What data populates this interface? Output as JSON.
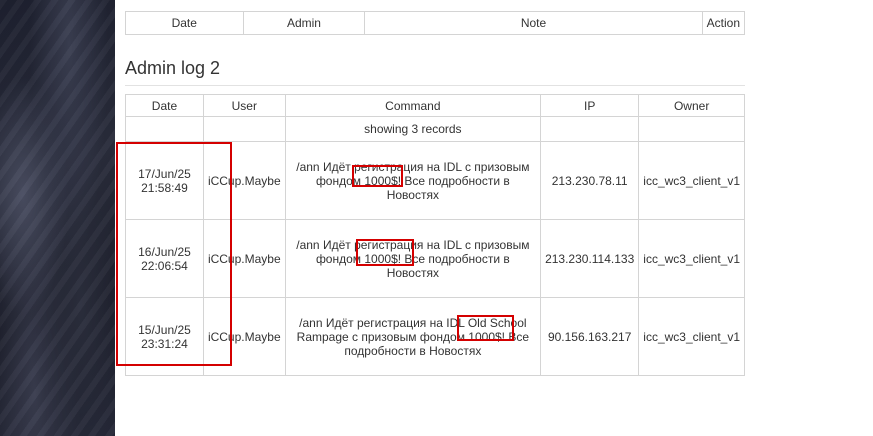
{
  "top_table": {
    "headers": {
      "date": "Date",
      "admin": "Admin",
      "note": "Note",
      "action": "Action"
    }
  },
  "section": {
    "title": "Admin log 2"
  },
  "log_table": {
    "headers": {
      "date": "Date",
      "user": "User",
      "command": "Command",
      "ip": "IP",
      "owner": "Owner"
    },
    "records_text": "showing 3 records",
    "rows": [
      {
        "date": "17/Jun/25",
        "time": "21:58:49",
        "user": "iCCup.Maybe",
        "command": "/ann Идёт регистрация на IDL с призовым фондом 1000$! Все подробности в Новостях",
        "ip": "213.230.78.11",
        "owner": "icc_wc3_client_v1"
      },
      {
        "date": "16/Jun/25",
        "time": "22:06:54",
        "user": "iCCup.Maybe",
        "command": "/ann Идёт регистрация на IDL с призовым фондом 1000$! Все подробности в Новостях",
        "ip": "213.230.114.133",
        "owner": "icc_wc3_client_v1"
      },
      {
        "date": "15/Jun/25",
        "time": "23:31:24",
        "user": "iCCup.Maybe",
        "command": "/ann Идёт регистрация на IDL Old School Rampage с призовым фондом 1000$! Все подробности в Новостях",
        "ip": "90.156.163.217",
        "owner": "icc_wc3_client_v1"
      }
    ]
  },
  "colors": {
    "highlight": "#d40000",
    "border": "#d4d4d4",
    "sidebar": "#1e2130"
  }
}
